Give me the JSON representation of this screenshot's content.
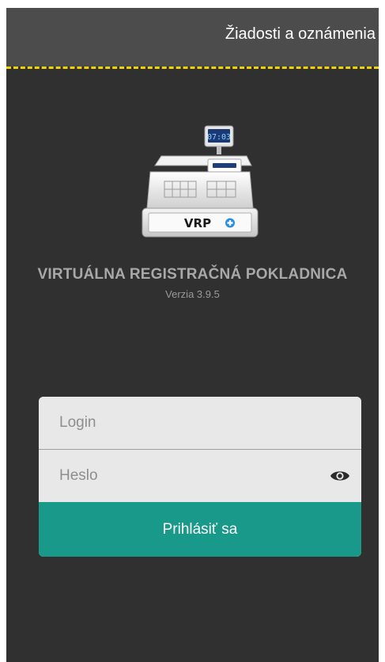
{
  "header": {
    "requests_link": "Žiadosti a oznámenia"
  },
  "logo": {
    "display_time": "07:03",
    "brand_text": "VRP"
  },
  "app": {
    "title": "VIRTUÁLNA REGISTRAČNÁ POKLADNICA",
    "version": "Verzia 3.9.5"
  },
  "login_form": {
    "login_placeholder": "Login",
    "login_value": "",
    "password_placeholder": "Heslo",
    "password_value": "",
    "submit_label": "Prihlásiť sa"
  },
  "icons": {
    "password_toggle": "eye-icon"
  },
  "colors": {
    "accent": "#18998a",
    "divider": "#f2d200",
    "background": "#303030",
    "app_bar": "#4c4c4c"
  }
}
